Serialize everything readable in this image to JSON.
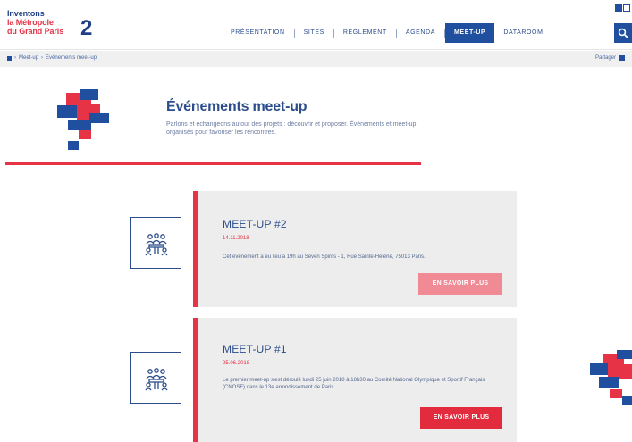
{
  "header": {
    "logo": {
      "line1": "Inventons",
      "line2": "la Métropole",
      "line3": "du Grand Paris",
      "number": "2"
    },
    "nav": [
      {
        "label": "PRÉSENTATION",
        "active": false
      },
      {
        "label": "SITES",
        "active": false
      },
      {
        "label": "RÈGLEMENT",
        "active": false
      },
      {
        "label": "AGENDA",
        "active": false
      },
      {
        "label": "MEET-UP",
        "active": true
      },
      {
        "label": "DATAROOM",
        "active": false
      }
    ],
    "search_icon": "search-icon",
    "language_icons": [
      "language-icon",
      "language-icon"
    ]
  },
  "breadcrumb": {
    "items": [
      "Meet-up",
      "Événements meet-up"
    ],
    "share_label": "Partager"
  },
  "hero": {
    "title": "Événements meet-up",
    "intro": "Parlons et échangeons autour des projets : découvrir et proposer. Événements et meet-up organisés pour favoriser les rencontres."
  },
  "events": [
    {
      "title": "MEET-UP #2",
      "date": "14.11.2018",
      "description": "Cet événement a eu lieu à 19h au Seven Spirits - 1, Rue Sainte-Hélène, 75013 Paris.",
      "button_label": "EN SAVOIR PLUS",
      "button_state": "disabled",
      "icon": "meeting-people-icon"
    },
    {
      "title": "MEET-UP #1",
      "date": "25.06.2018",
      "description": "Le premier meet-up s'est déroulé lundi 25 juin 2018 à 18h30 au Comité National Olympique et Sportif Français (CNOSF) dans le 13e arrondissement de Paris.",
      "button_label": "EN SAVOIR PLUS",
      "button_state": "enabled",
      "icon": "meeting-people-icon"
    }
  ],
  "colors": {
    "brand_blue": "#1f4f9e",
    "brand_red": "#e63346",
    "card_bg": "#ededed",
    "button_disabled": "#f08a95"
  }
}
